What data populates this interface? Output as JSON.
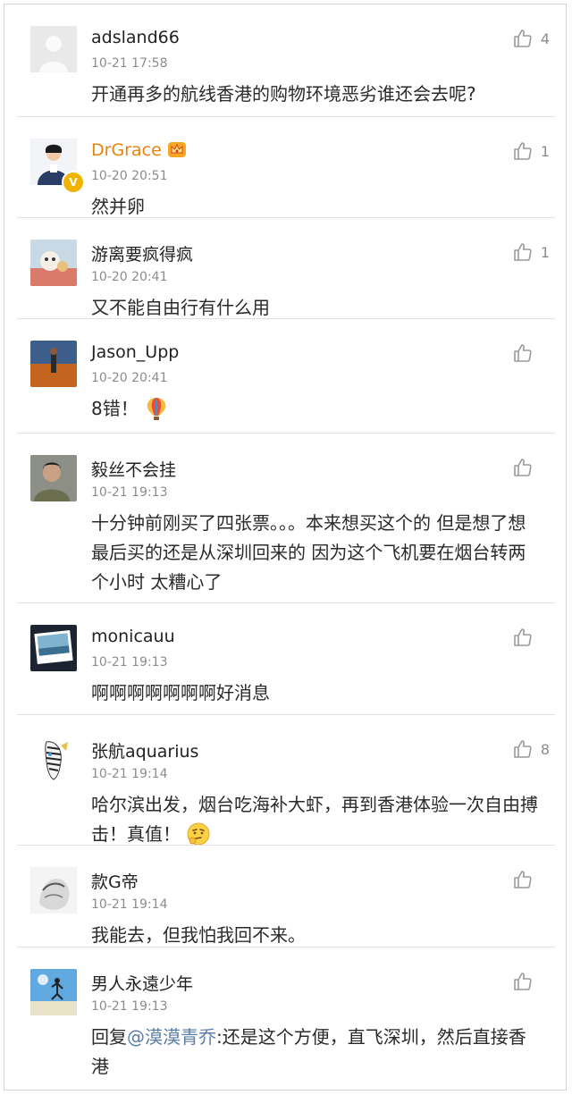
{
  "comments": [
    {
      "username": "adsland66",
      "time": "10-21 17:58",
      "text": "开通再多的航线香港的购物环境恶劣谁还会去呢?",
      "likes": "4",
      "avatar_icon": "default-avatar-icon"
    },
    {
      "username": "DrGrace",
      "time": "10-20 20:51",
      "text": "然并卵",
      "likes": "1",
      "verified": true,
      "vip_icon": "crown-badge-icon",
      "avatar_icon": "police-officer-avatar-icon"
    },
    {
      "username": "游离要疯得疯",
      "time": "10-20 20:41",
      "text": "又不能自由行有什么用",
      "likes": "1",
      "avatar_icon": "cartoon-avatar-icon"
    },
    {
      "username": "Jason_Upp",
      "time": "10-20 20:41",
      "text": "8错！",
      "likes": "",
      "emoji": "hot-air-balloon-emoji",
      "avatar_icon": "beach-person-avatar-icon"
    },
    {
      "username": "毅丝不会挂",
      "time": "10-21 19:13",
      "text": "十分钟前刚买了四张票。。。本来想买这个的  但是想了想最后买的还是从深圳回来的  因为这个飞机要在烟台转两个小时   太糟心了",
      "likes": "",
      "avatar_icon": "man-portrait-avatar-icon"
    },
    {
      "username": "monicauu",
      "time": "10-21 19:13",
      "text": "啊啊啊啊啊啊啊好消息",
      "likes": "",
      "avatar_icon": "polaroid-sea-avatar-icon"
    },
    {
      "username": "张航aquarius",
      "time": "10-21 19:14",
      "text": "哈尔滨出发，烟台吃海补大虾，再到香港体验一次自由搏击！真值！",
      "likes": "8",
      "emoji": "thinking-face-emoji",
      "avatar_icon": "zebra-avatar-icon"
    },
    {
      "username": "款G帝",
      "time": "10-21 19:14",
      "text": "我能去，但我怕我回不来。",
      "likes": "",
      "avatar_icon": "sketch-avatar-icon"
    },
    {
      "username": "男人永遠少年",
      "time": "10-21 19:13",
      "reply_prefix": "回复",
      "mention": "@漠漠青乔",
      "text": ":还是这个方便，直飞深圳，然后直接香港",
      "likes": "",
      "avatar_icon": "sky-jump-avatar-icon"
    }
  ],
  "colors": {
    "vip_name": "#e8820c",
    "mention": "#5b7ea6",
    "meta": "#8c8c8c",
    "divider": "#e1e1e1",
    "verified_badge": "#f0b400"
  },
  "icons": {
    "like": "thumbs-up-icon"
  }
}
